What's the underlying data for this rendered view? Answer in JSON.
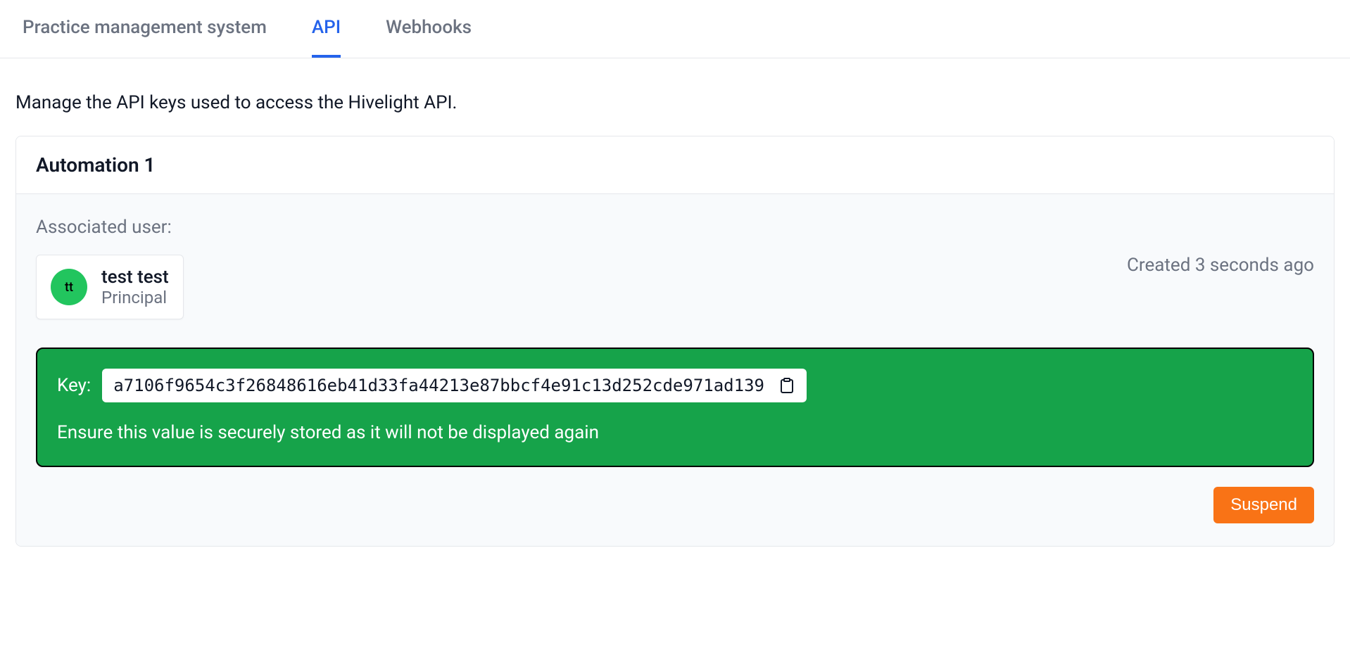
{
  "tabs": {
    "practice": "Practice management system",
    "api": "API",
    "webhooks": "Webhooks"
  },
  "description": "Manage the API keys used to access the Hivelight API.",
  "card": {
    "title": "Automation 1",
    "associated_label": "Associated user:",
    "user": {
      "initials": "tt",
      "name": "test test",
      "role": "Principal"
    },
    "created": "Created 3 seconds ago",
    "key": {
      "label": "Key:",
      "value": "a7106f9654c3f26848616eb41d33fa44213e87bbcf4e91c13d252cde971ad139",
      "warning": "Ensure this value is securely stored as it will not be displayed again"
    },
    "suspend_label": "Suspend"
  }
}
